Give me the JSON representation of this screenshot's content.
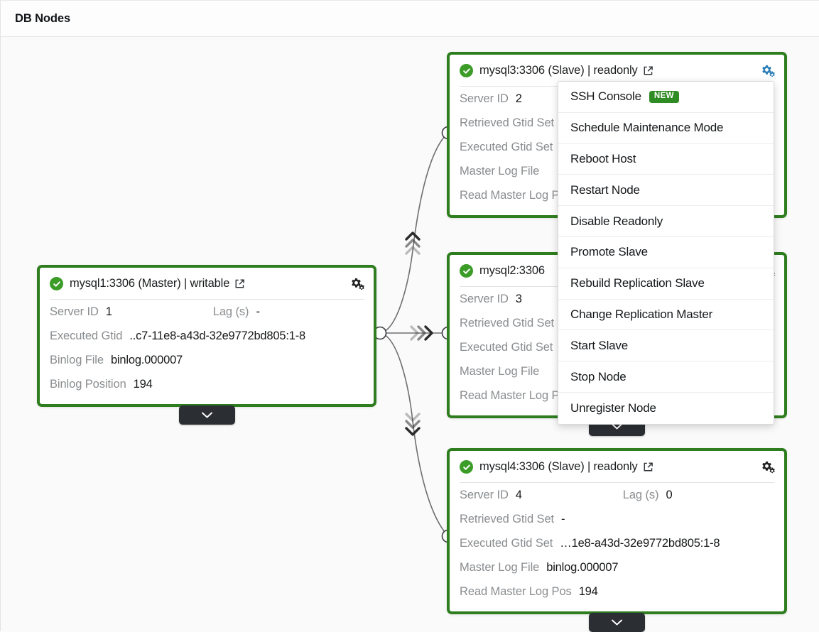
{
  "panel": {
    "title": "DB Nodes"
  },
  "colors": {
    "node_border_green": "#2e7d1e",
    "status_ok_green": "#3c9c28",
    "gear_active_blue": "#2e7fb8",
    "new_badge_green": "#2f8b23",
    "canvas_background": "#fafafa",
    "label_gray": "#8a8d90"
  },
  "nodes": [
    {
      "id": "mysql1",
      "title": "mysql1:3306 (Master) | writable",
      "status": "ok",
      "gear_state": "default",
      "rows": [
        {
          "label": "Server ID",
          "value": "1",
          "label2": "Lag (s)",
          "value2": "-"
        },
        {
          "label": "Executed Gtid",
          "value": "..c7-11e8-a43d-32e9772bd805:1-8"
        },
        {
          "label": "Binlog File",
          "value": "binlog.000007"
        },
        {
          "label": "Binlog Position",
          "value": "194"
        }
      ]
    },
    {
      "id": "mysql3",
      "title": "mysql3:3306 (Slave) | readonly",
      "status": "ok",
      "gear_state": "active",
      "rows": [
        {
          "label": "Server ID",
          "value": "2"
        },
        {
          "label": "Retrieved Gtid Set",
          "value": ""
        },
        {
          "label": "Executed Gtid Set",
          "value": ""
        },
        {
          "label": "Master Log File",
          "value": ""
        },
        {
          "label": "Read Master Log Pos",
          "value": ""
        }
      ]
    },
    {
      "id": "mysql2",
      "title": "mysql2:3306",
      "status": "ok",
      "gear_state": "default",
      "rows": [
        {
          "label": "Server ID",
          "value": "3"
        },
        {
          "label": "Retrieved Gtid Set",
          "value": ""
        },
        {
          "label": "Executed Gtid Set",
          "value": ""
        },
        {
          "label": "Master Log File",
          "value": ""
        },
        {
          "label": "Read Master Log Pos",
          "value": ""
        }
      ]
    },
    {
      "id": "mysql4",
      "title": "mysql4:3306 (Slave) | readonly",
      "status": "ok",
      "gear_state": "default",
      "rows": [
        {
          "label": "Server ID",
          "value": "4",
          "label2": "Lag (s)",
          "value2": "0"
        },
        {
          "label": "Retrieved Gtid Set",
          "value": "-"
        },
        {
          "label": "Executed Gtid Set",
          "value": "…1e8-a43d-32e9772bd805:1-8"
        },
        {
          "label": "Master Log File",
          "value": "binlog.000007"
        },
        {
          "label": "Read Master Log Pos",
          "value": "194"
        }
      ]
    }
  ],
  "menu": {
    "items": [
      {
        "label": "SSH Console",
        "badge": "NEW"
      },
      {
        "label": "Schedule Maintenance Mode",
        "badge": ""
      },
      {
        "label": "Reboot Host",
        "badge": ""
      },
      {
        "label": "Restart Node",
        "badge": ""
      },
      {
        "label": "Disable Readonly",
        "badge": ""
      },
      {
        "label": "Promote Slave",
        "badge": ""
      },
      {
        "label": "Rebuild Replication Slave",
        "badge": ""
      },
      {
        "label": "Change Replication Master",
        "badge": ""
      },
      {
        "label": "Start Slave",
        "badge": ""
      },
      {
        "label": "Stop Node",
        "badge": ""
      },
      {
        "label": "Unregister Node",
        "badge": ""
      }
    ]
  }
}
